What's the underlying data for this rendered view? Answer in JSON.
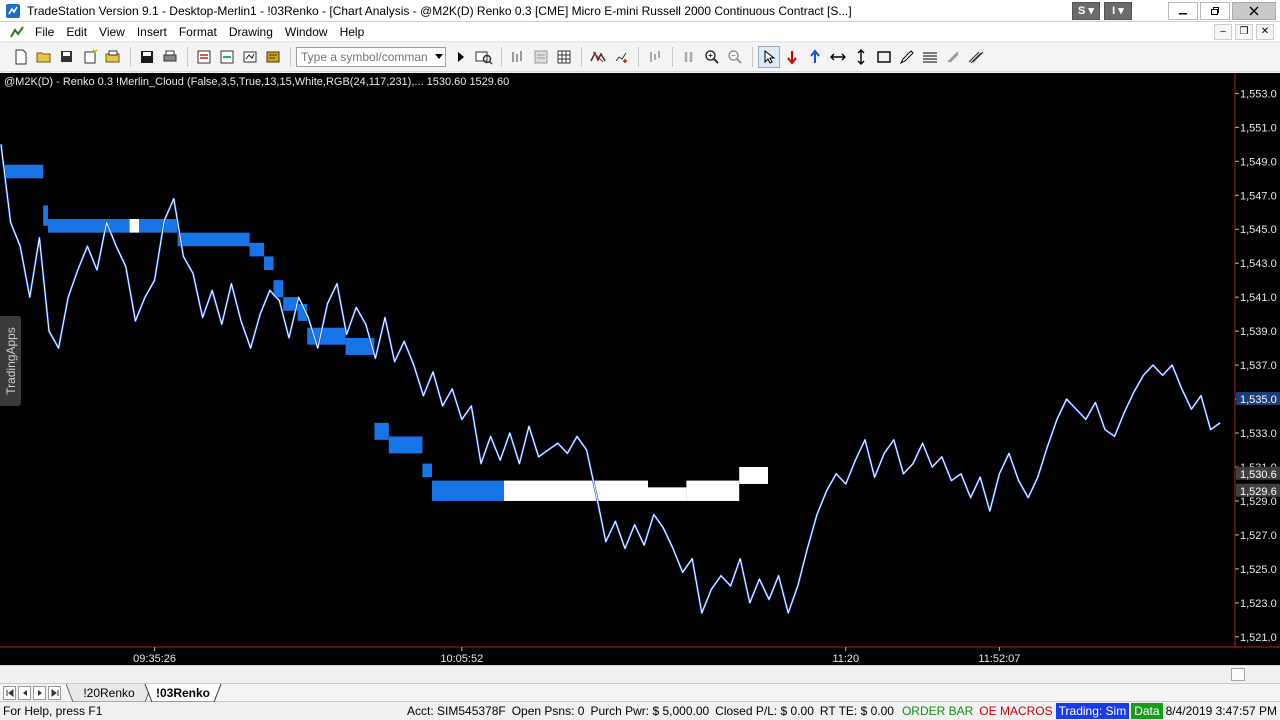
{
  "window": {
    "title": "TradeStation Version 9.1 - Desktop-Merlin1 - !03Renko - [Chart Analysis - @M2K(D) Renko 0.3 [CME] Micro E-mini Russell 2000 Continuous Contract [S...]",
    "btn_s": "S",
    "btn_i": "I"
  },
  "menu": {
    "items": [
      "File",
      "Edit",
      "View",
      "Insert",
      "Format",
      "Drawing",
      "Window",
      "Help"
    ]
  },
  "toolbar": {
    "symbol_placeholder": "Type a symbol/command"
  },
  "chart": {
    "header": "@M2K(D) - Renko 0.3  !Merlin_Cloud (False,3,5,True,13,15,White,RGB(24,117,231),...  1530.60  1529.60",
    "side_tab": "TradingApps",
    "colors": {
      "background": "#000000",
      "price_line": "#ffffff",
      "cloud_bear": "#1875e7",
      "cloud_bull": "#ffffff",
      "axis_divider": "#b41e1e",
      "last_price_tag": "#1c3d7a",
      "cloud_tag": "#3f3f3f"
    },
    "y_axis_labels": [
      "1,553.0",
      "1,551.0",
      "1,549.0",
      "1,547.0",
      "1,545.0",
      "1,543.0",
      "1,541.0",
      "1,539.0",
      "1,537.0",
      "1,535.0",
      "1,533.0",
      "1,531.0",
      "1,529.0",
      "1,527.0",
      "1,525.0",
      "1,523.0",
      "1,521.0"
    ],
    "y_axis_values": [
      1553,
      1551,
      1549,
      1547,
      1545,
      1543,
      1541,
      1539,
      1537,
      1535,
      1533,
      1531,
      1529,
      1527,
      1525,
      1523,
      1521
    ],
    "price_tags": [
      {
        "value": 1535.0,
        "label": "1,535.0",
        "style": "last"
      },
      {
        "value": 1530.6,
        "label": "1,530.6",
        "style": "cloud"
      },
      {
        "value": 1529.6,
        "label": "1,529.6",
        "style": "cloud"
      }
    ],
    "time_labels": [
      {
        "label": "09:35:26",
        "bar": 16
      },
      {
        "label": "10:05:52",
        "bar": 48
      },
      {
        "label": "11:20",
        "bar": 88
      },
      {
        "label": "11:52:07",
        "bar": 104
      }
    ]
  },
  "chart_data": {
    "type": "line",
    "y_range": [
      1520.4,
      1554.2
    ],
    "price_line": [
      [
        0,
        1550.0
      ],
      [
        1,
        1545.4
      ],
      [
        2,
        1544.0
      ],
      [
        3,
        1541.0
      ],
      [
        4,
        1544.5
      ],
      [
        5,
        1539.0
      ],
      [
        6,
        1538.0
      ],
      [
        7,
        1541.0
      ],
      [
        8,
        1542.6
      ],
      [
        9,
        1544.0
      ],
      [
        10,
        1542.6
      ],
      [
        11,
        1545.4
      ],
      [
        12,
        1544.0
      ],
      [
        13,
        1542.8
      ],
      [
        14,
        1539.6
      ],
      [
        15,
        1541.0
      ],
      [
        16,
        1542.0
      ],
      [
        17,
        1545.5
      ],
      [
        18,
        1546.8
      ],
      [
        19,
        1543.4
      ],
      [
        20,
        1542.4
      ],
      [
        21,
        1539.8
      ],
      [
        22,
        1541.4
      ],
      [
        23,
        1539.4
      ],
      [
        24,
        1541.8
      ],
      [
        25,
        1539.6
      ],
      [
        26,
        1538.0
      ],
      [
        27,
        1540.0
      ],
      [
        28,
        1541.4
      ],
      [
        29,
        1540.8
      ],
      [
        30,
        1538.6
      ],
      [
        31,
        1541.0
      ],
      [
        32,
        1539.8
      ],
      [
        33,
        1538.0
      ],
      [
        34,
        1540.6
      ],
      [
        35,
        1541.8
      ],
      [
        36,
        1538.8
      ],
      [
        37,
        1540.4
      ],
      [
        38,
        1539.4
      ],
      [
        39,
        1537.4
      ],
      [
        40,
        1539.8
      ],
      [
        41,
        1537.2
      ],
      [
        42,
        1538.4
      ],
      [
        43,
        1537.0
      ],
      [
        44,
        1535.2
      ],
      [
        45,
        1536.6
      ],
      [
        46,
        1534.6
      ],
      [
        47,
        1535.6
      ],
      [
        48,
        1533.8
      ],
      [
        49,
        1534.6
      ],
      [
        50,
        1531.2
      ],
      [
        51,
        1532.8
      ],
      [
        52,
        1531.4
      ],
      [
        53,
        1533.0
      ],
      [
        54,
        1531.2
      ],
      [
        55,
        1533.4
      ],
      [
        56,
        1531.6
      ],
      [
        57,
        1532.0
      ],
      [
        58,
        1532.4
      ],
      [
        59,
        1531.8
      ],
      [
        60,
        1532.8
      ],
      [
        61,
        1532.0
      ],
      [
        62,
        1529.4
      ],
      [
        63,
        1526.6
      ],
      [
        64,
        1527.8
      ],
      [
        65,
        1526.2
      ],
      [
        66,
        1527.6
      ],
      [
        67,
        1526.4
      ],
      [
        68,
        1528.2
      ],
      [
        69,
        1527.4
      ],
      [
        70,
        1526.2
      ],
      [
        71,
        1524.8
      ],
      [
        72,
        1525.6
      ],
      [
        73,
        1522.4
      ],
      [
        74,
        1523.8
      ],
      [
        75,
        1524.6
      ],
      [
        76,
        1524.0
      ],
      [
        77,
        1525.6
      ],
      [
        78,
        1523.0
      ],
      [
        79,
        1524.4
      ],
      [
        80,
        1523.2
      ],
      [
        81,
        1524.6
      ],
      [
        82,
        1522.4
      ],
      [
        83,
        1524.0
      ],
      [
        84,
        1526.2
      ],
      [
        85,
        1528.2
      ],
      [
        86,
        1529.6
      ],
      [
        87,
        1530.6
      ],
      [
        88,
        1530.0
      ],
      [
        89,
        1531.4
      ],
      [
        90,
        1532.6
      ],
      [
        91,
        1530.4
      ],
      [
        92,
        1531.8
      ],
      [
        93,
        1532.6
      ],
      [
        94,
        1530.6
      ],
      [
        95,
        1531.2
      ],
      [
        96,
        1532.4
      ],
      [
        97,
        1531.0
      ],
      [
        98,
        1531.6
      ],
      [
        99,
        1530.2
      ],
      [
        100,
        1530.6
      ],
      [
        101,
        1529.2
      ],
      [
        102,
        1530.4
      ],
      [
        103,
        1528.4
      ],
      [
        104,
        1530.6
      ],
      [
        105,
        1531.8
      ],
      [
        106,
        1530.2
      ],
      [
        107,
        1529.2
      ],
      [
        108,
        1530.4
      ],
      [
        109,
        1532.2
      ],
      [
        110,
        1533.8
      ],
      [
        111,
        1535.0
      ],
      [
        112,
        1534.4
      ],
      [
        113,
        1533.8
      ],
      [
        114,
        1534.8
      ],
      [
        115,
        1533.2
      ],
      [
        116,
        1532.8
      ],
      [
        117,
        1534.2
      ],
      [
        118,
        1535.4
      ],
      [
        119,
        1536.4
      ],
      [
        120,
        1537.0
      ],
      [
        121,
        1536.4
      ],
      [
        122,
        1537.0
      ],
      [
        123,
        1535.6
      ],
      [
        124,
        1534.4
      ],
      [
        125,
        1535.2
      ],
      [
        126,
        1533.2
      ],
      [
        127,
        1533.6
      ]
    ],
    "cloud": [
      {
        "x0": 1,
        "x1": 9,
        "top": 1548.8,
        "bottom": 1548.0,
        "color": "bear"
      },
      {
        "x0": 9,
        "x1": 10,
        "top": 1546.4,
        "bottom": 1545.2,
        "color": "bear"
      },
      {
        "x0": 10,
        "x1": 27,
        "top": 1545.6,
        "bottom": 1544.8,
        "color": "bear"
      },
      {
        "x0": 27,
        "x1": 29,
        "top": 1545.6,
        "bottom": 1544.8,
        "color": "bull"
      },
      {
        "x0": 29,
        "x1": 37,
        "top": 1545.6,
        "bottom": 1544.8,
        "color": "bear"
      },
      {
        "x0": 37,
        "x1": 52,
        "top": 1544.8,
        "bottom": 1544.0,
        "color": "bear"
      },
      {
        "x0": 52,
        "x1": 55,
        "top": 1544.2,
        "bottom": 1543.4,
        "color": "bear"
      },
      {
        "x0": 55,
        "x1": 57,
        "top": 1543.4,
        "bottom": 1542.6,
        "color": "bear"
      },
      {
        "x0": 57,
        "x1": 59,
        "top": 1542.0,
        "bottom": 1541.0,
        "color": "bear"
      },
      {
        "x0": 59,
        "x1": 62,
        "top": 1541.0,
        "bottom": 1540.2,
        "color": "bear"
      },
      {
        "x0": 62,
        "x1": 64,
        "top": 1540.6,
        "bottom": 1539.6,
        "color": "bear"
      },
      {
        "x0": 64,
        "x1": 72,
        "top": 1539.2,
        "bottom": 1538.2,
        "color": "bear"
      },
      {
        "x0": 72,
        "x1": 78,
        "top": 1538.6,
        "bottom": 1537.6,
        "color": "bear"
      },
      {
        "x0": 78,
        "x1": 81,
        "top": 1533.6,
        "bottom": 1532.6,
        "color": "bear"
      },
      {
        "x0": 81,
        "x1": 88,
        "top": 1532.8,
        "bottom": 1531.8,
        "color": "bear"
      },
      {
        "x0": 88,
        "x1": 90,
        "top": 1531.2,
        "bottom": 1530.4,
        "color": "bear"
      },
      {
        "x0": 90,
        "x1": 105,
        "top": 1530.2,
        "bottom": 1529.0,
        "color": "bear"
      },
      {
        "x0": 105,
        "x1": 135,
        "top": 1530.2,
        "bottom": 1529.0,
        "color": "bull"
      },
      {
        "x0": 135,
        "x1": 143,
        "top": 1529.8,
        "bottom": 1529.0,
        "color": "bull"
      },
      {
        "x0": 143,
        "x1": 154,
        "top": 1530.2,
        "bottom": 1529.0,
        "color": "bull"
      },
      {
        "x0": 154,
        "x1": 160,
        "top": 1531.0,
        "bottom": 1530.0,
        "color": "bull"
      }
    ]
  },
  "tabs": {
    "items": [
      "!20Renko",
      "!03Renko"
    ],
    "active": 1
  },
  "status": {
    "help": "For Help, press F1",
    "acct": "Acct: SIM545378F",
    "open_psns": "Open Psns: 0",
    "purch_pwr": "Purch Pwr: $ 5,000.00",
    "closed_pl": "Closed P/L: $ 0.00",
    "rt_te": "RT TE: $ 0.00",
    "order_bar": "ORDER BAR",
    "oe_macros": "OE MACROS",
    "trading": "Trading: Sim",
    "data": "Data",
    "datetime": "8/4/2019 3:47:57 PM"
  }
}
